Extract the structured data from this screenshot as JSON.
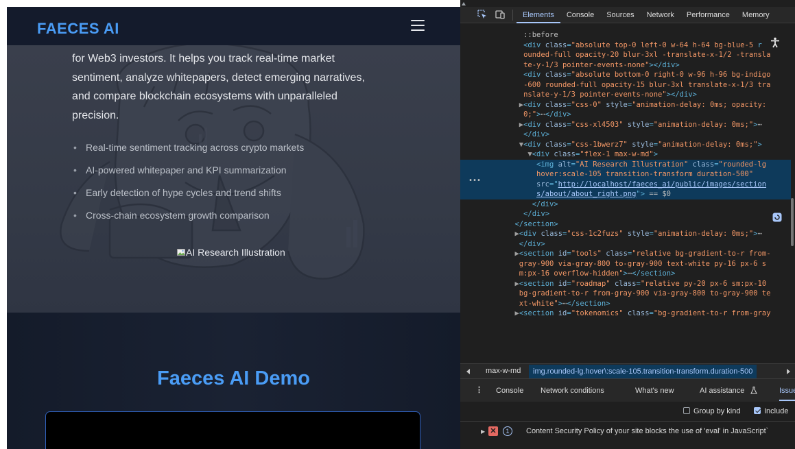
{
  "site": {
    "logo": "FAECES AI",
    "about": {
      "paragraph_lines": [
        "for Web3 investors. It helps you track real-time market",
        "sentiment, analyze whitepapers, detect emerging narratives,",
        "and compare blockchain ecosystems with unparalleled",
        "precision."
      ],
      "bullets": [
        "Real-time sentiment tracking across crypto markets",
        "AI-powered whitepaper and KPI summarization",
        "Early detection of hype cycles and trend shifts",
        "Cross-chain ecosystem growth comparison"
      ],
      "image_alt": "AI Research Illustration"
    },
    "demo": {
      "title": "Faeces AI Demo"
    }
  },
  "devtools": {
    "tabs": [
      "Elements",
      "Console",
      "Sources",
      "Network",
      "Performance",
      "Memory"
    ],
    "active_tab": "Elements",
    "dom_lines": [
      {
        "i": 7,
        "parts": [
          [
            "pseudo",
            "::before"
          ]
        ]
      },
      {
        "i": 7,
        "parts": [
          [
            "tag",
            "<div "
          ],
          [
            "attr",
            "class"
          ],
          [
            "tag",
            "="
          ],
          [
            "val",
            "\"absolute top-0 left-0 w-64 h-64 bg-blue-5"
          ],
          [
            "tag",
            " r"
          ]
        ]
      },
      {
        "i": 7,
        "parts": [
          [
            "val",
            "ounded-full opacity-20 blur-3xl -translate-x-1/2 -transla"
          ]
        ]
      },
      {
        "i": 7,
        "parts": [
          [
            "val",
            "te-y-1/3 pointer-events-none\""
          ],
          [
            "tag",
            "></div>"
          ]
        ]
      },
      {
        "i": 7,
        "parts": [
          [
            "tag",
            "<div "
          ],
          [
            "attr",
            "class"
          ],
          [
            "tag",
            "="
          ],
          [
            "val",
            "\"absolute bottom-0 right-0 w-96 h-96 bg-indigo"
          ]
        ]
      },
      {
        "i": 7,
        "parts": [
          [
            "val",
            "-600 rounded-full opacity-15 blur-3xl translate-x-1/3 tra"
          ]
        ]
      },
      {
        "i": 7,
        "parts": [
          [
            "val",
            "nslate-y-1/3 pointer-events-none\""
          ],
          [
            "tag",
            "></div>"
          ]
        ]
      },
      {
        "i": 6,
        "parts": [
          [
            "arrow",
            "▶"
          ],
          [
            "tag",
            "<div "
          ],
          [
            "attr",
            "class"
          ],
          [
            "tag",
            "="
          ],
          [
            "val",
            "\"css-0\" "
          ],
          [
            "attr",
            "style"
          ],
          [
            "tag",
            "="
          ],
          [
            "val",
            "\"animation-delay: 0ms; opacity:"
          ]
        ]
      },
      {
        "i": 7,
        "parts": [
          [
            "val",
            "0;\""
          ],
          [
            "tag",
            ">"
          ],
          [
            "pseudo",
            "⋯"
          ],
          [
            "tag",
            "</div>"
          ]
        ]
      },
      {
        "i": 6,
        "parts": [
          [
            "arrow",
            "▶"
          ],
          [
            "tag",
            "<div "
          ],
          [
            "attr",
            "class"
          ],
          [
            "tag",
            "="
          ],
          [
            "val",
            "\"css-xl4503\" "
          ],
          [
            "attr",
            "style"
          ],
          [
            "tag",
            "="
          ],
          [
            "val",
            "\"animation-delay: 0ms;\""
          ],
          [
            "tag",
            ">"
          ],
          [
            "pseudo",
            "⋯"
          ]
        ]
      },
      {
        "i": 7,
        "parts": [
          [
            "tag",
            "</div>"
          ]
        ]
      },
      {
        "i": 6,
        "parts": [
          [
            "arrow",
            "▼"
          ],
          [
            "tag",
            "<div "
          ],
          [
            "attr",
            "class"
          ],
          [
            "tag",
            "="
          ],
          [
            "val",
            "\"css-1bwerz7\" "
          ],
          [
            "attr",
            "style"
          ],
          [
            "tag",
            "="
          ],
          [
            "val",
            "\"animation-delay: 0ms;\""
          ],
          [
            "tag",
            ">"
          ]
        ]
      },
      {
        "i": 8,
        "parts": [
          [
            "arrow",
            "▼"
          ],
          [
            "tag",
            "<div "
          ],
          [
            "attr",
            "class"
          ],
          [
            "tag",
            "="
          ],
          [
            "val",
            "\"flex-1 max-w-md\""
          ],
          [
            "tag",
            ">"
          ]
        ]
      },
      {
        "i": 10,
        "sel": true,
        "parts": [
          [
            "tag",
            "<img "
          ],
          [
            "attr",
            "alt"
          ],
          [
            "tag",
            "="
          ],
          [
            "val",
            "\"AI Research Illustration\" "
          ],
          [
            "attr",
            "class"
          ],
          [
            "tag",
            "="
          ],
          [
            "val",
            "\"rounded-lg"
          ]
        ]
      },
      {
        "i": 10,
        "sel": true,
        "parts": [
          [
            "val",
            "hover:scale-105 transition-transform duration-500\""
          ]
        ]
      },
      {
        "i": 10,
        "sel": true,
        "parts": [
          [
            "attr",
            "src"
          ],
          [
            "tag",
            "=\""
          ],
          [
            "link",
            "http://localhost/faeces_ai/public/images/section"
          ]
        ]
      },
      {
        "i": 10,
        "sel": true,
        "parts": [
          [
            "link",
            "s/about/about_right.png"
          ],
          [
            "tag",
            "\"> "
          ],
          [
            "pseudo",
            "== $0"
          ]
        ]
      },
      {
        "i": 9,
        "parts": [
          [
            "tag",
            "</div>"
          ]
        ]
      },
      {
        "i": 7,
        "parts": [
          [
            "tag",
            "</div>"
          ]
        ]
      },
      {
        "i": 5,
        "parts": [
          [
            "tag",
            "</section>"
          ]
        ]
      },
      {
        "i": 5,
        "parts": [
          [
            "arrow",
            "▶"
          ],
          [
            "tag",
            "<div "
          ],
          [
            "attr",
            "class"
          ],
          [
            "tag",
            "="
          ],
          [
            "val",
            "\"css-1c2fuzs\" "
          ],
          [
            "attr",
            "style"
          ],
          [
            "tag",
            "="
          ],
          [
            "val",
            "\"animation-delay: 0ms;\""
          ],
          [
            "tag",
            ">"
          ],
          [
            "pseudo",
            "⋯"
          ]
        ]
      },
      {
        "i": 6,
        "parts": [
          [
            "tag",
            "</div>"
          ]
        ]
      },
      {
        "i": 5,
        "parts": [
          [
            "arrow",
            "▶"
          ],
          [
            "tag",
            "<section "
          ],
          [
            "attr",
            "id"
          ],
          [
            "tag",
            "="
          ],
          [
            "val",
            "\"tools\" "
          ],
          [
            "attr",
            "class"
          ],
          [
            "tag",
            "="
          ],
          [
            "val",
            "\"relative bg-gradient-to-r from-"
          ]
        ]
      },
      {
        "i": 6,
        "parts": [
          [
            "val",
            "gray-900 via-gray-800 to-gray-900 text-white py-16 px-6 s"
          ]
        ]
      },
      {
        "i": 6,
        "parts": [
          [
            "val",
            "m:px-16 overflow-hidden\""
          ],
          [
            "tag",
            ">"
          ],
          [
            "pseudo",
            "⋯"
          ],
          [
            "tag",
            "</section>"
          ]
        ]
      },
      {
        "i": 5,
        "parts": [
          [
            "arrow",
            "▶"
          ],
          [
            "tag",
            "<section "
          ],
          [
            "attr",
            "id"
          ],
          [
            "tag",
            "="
          ],
          [
            "val",
            "\"roadmap\" "
          ],
          [
            "attr",
            "class"
          ],
          [
            "tag",
            "="
          ],
          [
            "val",
            "\"relative py-20 px-6 sm:px-10"
          ]
        ]
      },
      {
        "i": 6,
        "parts": [
          [
            "val",
            "bg-gradient-to-r from-gray-900 via-gray-800 to-gray-900 te"
          ]
        ]
      },
      {
        "i": 6,
        "parts": [
          [
            "val",
            "xt-white\""
          ],
          [
            "tag",
            ">"
          ],
          [
            "pseudo",
            "⋯"
          ],
          [
            "tag",
            "</section>"
          ]
        ]
      },
      {
        "i": 5,
        "parts": [
          [
            "arrow",
            "▶"
          ],
          [
            "tag",
            "<section "
          ],
          [
            "attr",
            "id"
          ],
          [
            "tag",
            "="
          ],
          [
            "val",
            "\"tokenomics\" "
          ],
          [
            "attr",
            "class"
          ],
          [
            "tag",
            "="
          ],
          [
            "val",
            "\"bg-gradient-to-r from-gray"
          ]
        ]
      }
    ],
    "breadcrumbs": [
      "max-w-md",
      "img.rounded-lg.hover\\:scale-105.transition-transform.duration-500"
    ],
    "drawer_tabs": [
      "Console",
      "Network conditions",
      "What's new",
      "AI assistance",
      "Issues"
    ],
    "filters": {
      "group_by_kind": "Group by kind",
      "include": "Include"
    },
    "issue": {
      "count": "1",
      "text": "Content Security Policy of your site blocks the use of 'eval' in JavaScript`"
    },
    "colors": {
      "accent": "#a8c7fa",
      "brand_blue": "#4a9cf5",
      "error_red": "#e46962"
    }
  }
}
